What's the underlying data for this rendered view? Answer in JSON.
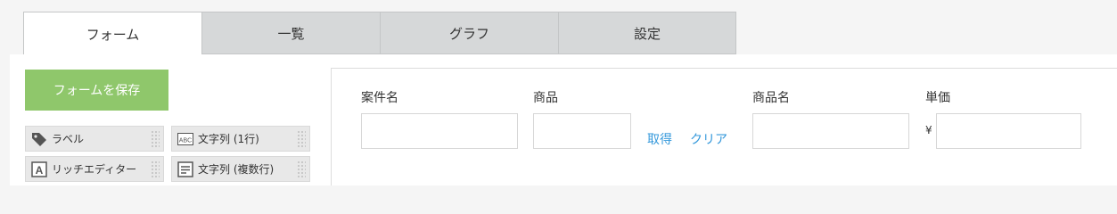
{
  "tabs": [
    {
      "label": "フォーム"
    },
    {
      "label": "一覧"
    },
    {
      "label": "グラフ"
    },
    {
      "label": "設定"
    }
  ],
  "left_panel": {
    "save_button": "フォームを保存",
    "palette": [
      {
        "label": "ラベル",
        "icon": "tag-icon"
      },
      {
        "label": "文字列 (1行)",
        "icon": "abc-icon"
      },
      {
        "label": "リッチエディター",
        "icon": "rich-editor-icon"
      },
      {
        "label": "文字列 (複数行)",
        "icon": "multiline-text-icon"
      }
    ]
  },
  "form": {
    "fields": {
      "case_name": {
        "label": "案件名",
        "value": ""
      },
      "product": {
        "label": "商品",
        "value": ""
      },
      "product_name": {
        "label": "商品名",
        "value": ""
      },
      "unit_price": {
        "label": "単価",
        "value": "",
        "currency": "¥"
      }
    },
    "links": {
      "fetch": "取得",
      "clear": "クリア"
    }
  },
  "colors": {
    "accent_green": "#8fc76b",
    "link_blue": "#3498db",
    "tab_inactive": "#d6d8d9"
  }
}
